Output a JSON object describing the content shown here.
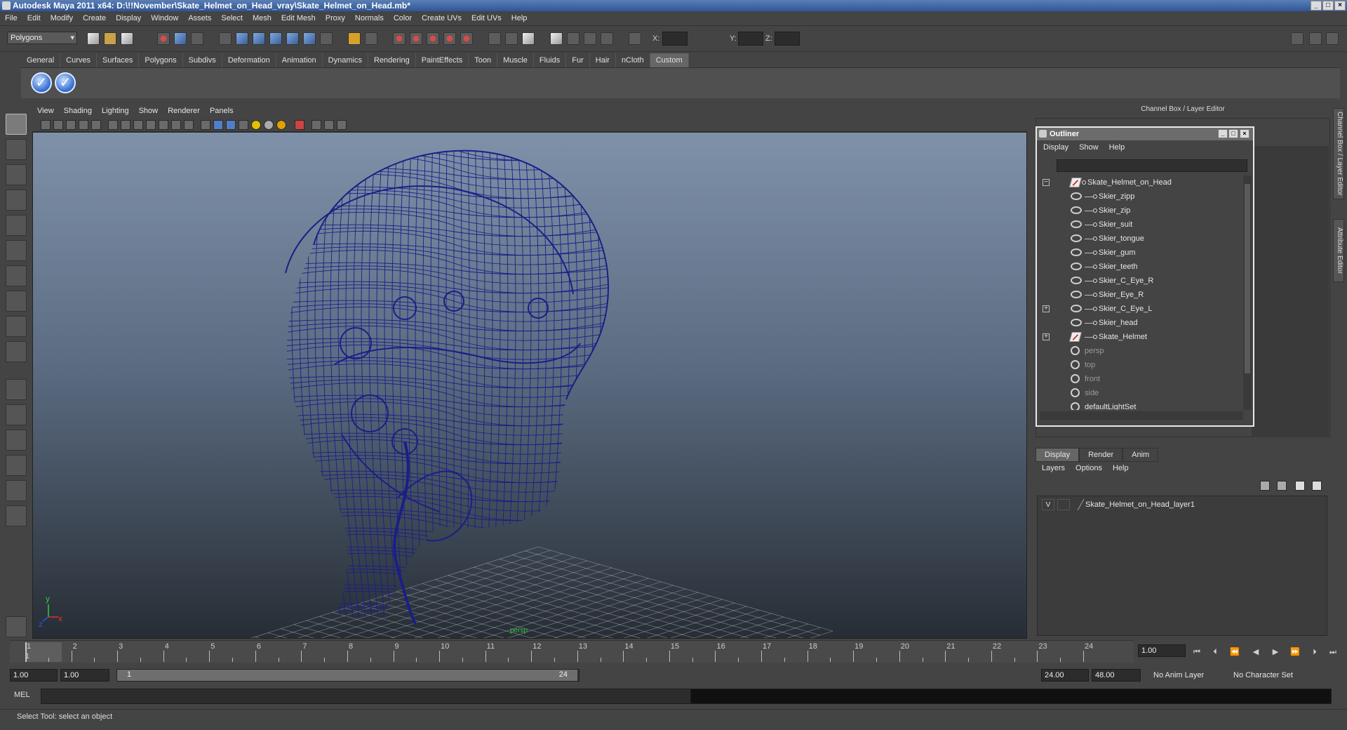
{
  "window": {
    "title": "Autodesk Maya 2011 x64: D:\\!!November\\Skate_Helmet_on_Head_vray\\Skate_Helmet_on_Head.mb*",
    "controls": [
      "_",
      "□",
      "×"
    ]
  },
  "menubar": [
    "File",
    "Edit",
    "Modify",
    "Create",
    "Display",
    "Window",
    "Assets",
    "Select",
    "Mesh",
    "Edit Mesh",
    "Proxy",
    "Normals",
    "Color",
    "Create UVs",
    "Edit UVs",
    "Help"
  ],
  "statusline": {
    "mode": "Polygons",
    "x_label": "X:",
    "y_label": "Y:",
    "z_label": "Z:"
  },
  "shelf": {
    "tabs": [
      "General",
      "Curves",
      "Surfaces",
      "Polygons",
      "Subdivs",
      "Deformation",
      "Animation",
      "Dynamics",
      "Rendering",
      "PaintEffects",
      "Toon",
      "Muscle",
      "Fluids",
      "Fur",
      "Hair",
      "nCloth",
      "Custom"
    ],
    "active_tab": "Custom",
    "buttons": [
      "check-icon",
      "check-icon"
    ]
  },
  "viewport": {
    "menu": [
      "View",
      "Shading",
      "Lighting",
      "Show",
      "Renderer",
      "Panels"
    ],
    "axis_y": "y",
    "axis_x": "x",
    "axis_z": "z",
    "wire_color": "#1a1f86",
    "grid_color": "#cfcfcf",
    "persp_label": "persp"
  },
  "channel_box": {
    "header": "Channel Box / Layer Editor"
  },
  "side_tabs": [
    "Channel Box / Layer Editor",
    "Attribute Editor"
  ],
  "outliner": {
    "title": "Outliner",
    "menu": [
      "Display",
      "Show",
      "Help"
    ],
    "root": "Skate_Helmet_on_Head",
    "children": [
      "Skier_zipp",
      "Skier_zip",
      "Skier_suit",
      "Skier_tongue",
      "Skier_gum",
      "Skier_teeth",
      "Skier_C_Eye_R",
      "Skier_Eye_R",
      "Skier_C_Eye_L",
      "Skier_head",
      "Skate_Helmet"
    ],
    "cameras": [
      "persp",
      "top",
      "front",
      "side"
    ],
    "last": "defaultLightSet"
  },
  "layer_editor": {
    "tabs": [
      "Display",
      "Render",
      "Anim"
    ],
    "active_tab": "Display",
    "menu": [
      "Layers",
      "Options",
      "Help"
    ],
    "layer": {
      "visible": "V",
      "name": "Skate_Helmet_on_Head_layer1"
    }
  },
  "timeline": {
    "frames": [
      "1",
      "2",
      "3",
      "4",
      "5",
      "6",
      "7",
      "8",
      "9",
      "10",
      "11",
      "12",
      "13",
      "14",
      "15",
      "16",
      "17",
      "18",
      "19",
      "20",
      "21",
      "22",
      "23",
      "24"
    ],
    "current_frame_label": "1",
    "current_time": "1.00"
  },
  "range": {
    "start": "1.00",
    "playback_start": "1.00",
    "slider_start": "1",
    "slider_end": "24",
    "playback_end": "24.00",
    "end": "48.00",
    "anim_layer": "No Anim Layer",
    "character_set": "No Character Set"
  },
  "command_line": {
    "label": "MEL"
  },
  "help_line": "Select Tool: select an object"
}
